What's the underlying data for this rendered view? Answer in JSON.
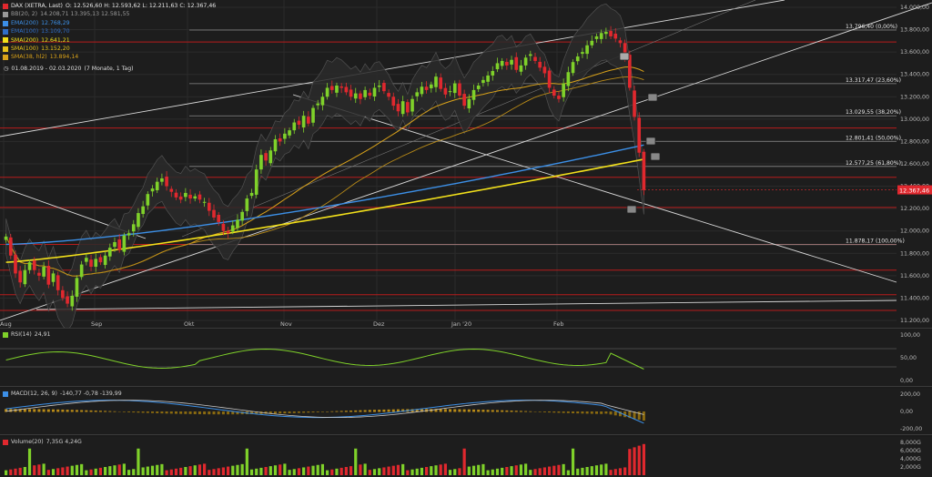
{
  "header": {
    "instrument": "DAX (XETRA, Last)",
    "ohlc": "O: 12.526,60  H: 12.593,62  L: 12.211,63  C: 12.367,46",
    "period": "01.08.2019 - 02.03.2020",
    "period_note": "(7 Monate, 1 Tag)"
  },
  "legend": [
    {
      "label": "BB(20, 2)",
      "values": "14.208,71  13.395,13  12.581,55",
      "color": "#9a9a9a"
    },
    {
      "label": "EMA(200)",
      "values": "12.768,29",
      "color": "#3c8fe6"
    },
    {
      "label": "EMA(100)",
      "values": "13.109,70",
      "color": "#2f6fc9"
    },
    {
      "label": "SMA(200)",
      "values": "12.641,21",
      "color": "#f2e01b"
    },
    {
      "label": "SMA(100)",
      "values": "13.152,20",
      "color": "#e8c21a"
    },
    {
      "label": "SMA(38, hl2)",
      "values": "13.894,14",
      "color": "#d9a21a"
    }
  ],
  "colors": {
    "up": "#7fd12a",
    "down": "#e0282e",
    "grid": "#2c2c2c",
    "hline": "#b71c1c"
  },
  "chart_data": [
    {
      "type": "candlestick",
      "title": "DAX (XETRA, Last)",
      "x_labels": [
        "Aug",
        "Sep",
        "Okt",
        "Nov",
        "Dez",
        "Jan '20",
        "Feb"
      ],
      "y_ticks": [
        "14.000,00",
        "13.800,00",
        "13.600,00",
        "13.400,00",
        "13.200,00",
        "13.000,00",
        "12.800,00",
        "12.600,00",
        "12.400,00",
        "12.200,00",
        "12.000,00",
        "11.800,00",
        "11.600,00",
        "11.400,00",
        "11.200,00"
      ],
      "ylim": [
        11200,
        14000
      ],
      "last_price_label": "12.367,46",
      "last_price": 12367.46,
      "fib_levels": [
        {
          "label": "13.796,40 (0,00%)",
          "value": 13796.4
        },
        {
          "label": "13.317,47 (23,60%)",
          "value": 13317.47
        },
        {
          "label": "13.029,55 (38,20%)",
          "value": 13029.55
        },
        {
          "label": "12.801,41 (50,00%)",
          "value": 12801.41
        },
        {
          "label": "12.577,25 (61,80%)",
          "value": 12577.25
        },
        {
          "label": "11.878,17 (100,00%)",
          "value": 11878.17
        }
      ],
      "red_lines": [
        13690,
        12920,
        12480,
        12210,
        11880,
        11650,
        11430,
        11290
      ],
      "close": [
        11950,
        11780,
        11620,
        11540,
        11650,
        11720,
        11650,
        11600,
        11680,
        11520,
        11620,
        11470,
        11400,
        11350,
        11420,
        11580,
        11700,
        11760,
        11680,
        11750,
        11720,
        11780,
        11850,
        11900,
        11830,
        11960,
        11980,
        12060,
        12160,
        12220,
        12330,
        12380,
        12440,
        12470,
        12400,
        12350,
        12300,
        12280,
        12340,
        12290,
        12310,
        12280,
        12260,
        12180,
        12120,
        12080,
        12000,
        11980,
        12050,
        12100,
        12170,
        12290,
        12340,
        12550,
        12680,
        12630,
        12720,
        12820,
        12800,
        12870,
        12900,
        12970,
        12950,
        13030,
        12960,
        13100,
        13140,
        13200,
        13280,
        13260,
        13300,
        13280,
        13240,
        13200,
        13230,
        13180,
        13260,
        13210,
        13280,
        13300,
        13250,
        13200,
        13120,
        13070,
        13160,
        13060,
        13180,
        13240,
        13290,
        13260,
        13310,
        13380,
        13270,
        13220,
        13250,
        13320,
        13210,
        13120,
        13180,
        13260,
        13300,
        13350,
        13390,
        13430,
        13500,
        13520,
        13480,
        13530,
        13440,
        13480,
        13550,
        13580,
        13520,
        13460,
        13410,
        13280,
        13210,
        13180,
        13320,
        13420,
        13510,
        13560,
        13600,
        13660,
        13700,
        13740,
        13770,
        13780,
        13740,
        13720,
        13680,
        13560,
        13280,
        13020,
        12700,
        12367
      ],
      "ema200": {
        "start": 11880,
        "end": 12768
      },
      "sma200": {
        "start": 11720,
        "end": 12641
      }
    },
    {
      "type": "line",
      "title": "RSI(14)",
      "last_value_label": "24,91",
      "y_ticks": [
        "100,00",
        "50,00",
        "0,00"
      ],
      "ylim": [
        0,
        100
      ]
    },
    {
      "type": "line",
      "title": "MACD(12, 26, 9)",
      "values_label": "-140,77  -0,78  -139,99",
      "y_ticks": [
        "200,00",
        "0,00",
        "-200,00"
      ],
      "ylim": [
        -200,
        200
      ]
    },
    {
      "type": "bar",
      "title": "Volume(20)",
      "values_label": "7,35G  4,24G",
      "y_ticks": [
        "8,000G",
        "6,000G",
        "4,000G",
        "2,000G"
      ],
      "ylim": [
        0,
        8
      ]
    }
  ]
}
